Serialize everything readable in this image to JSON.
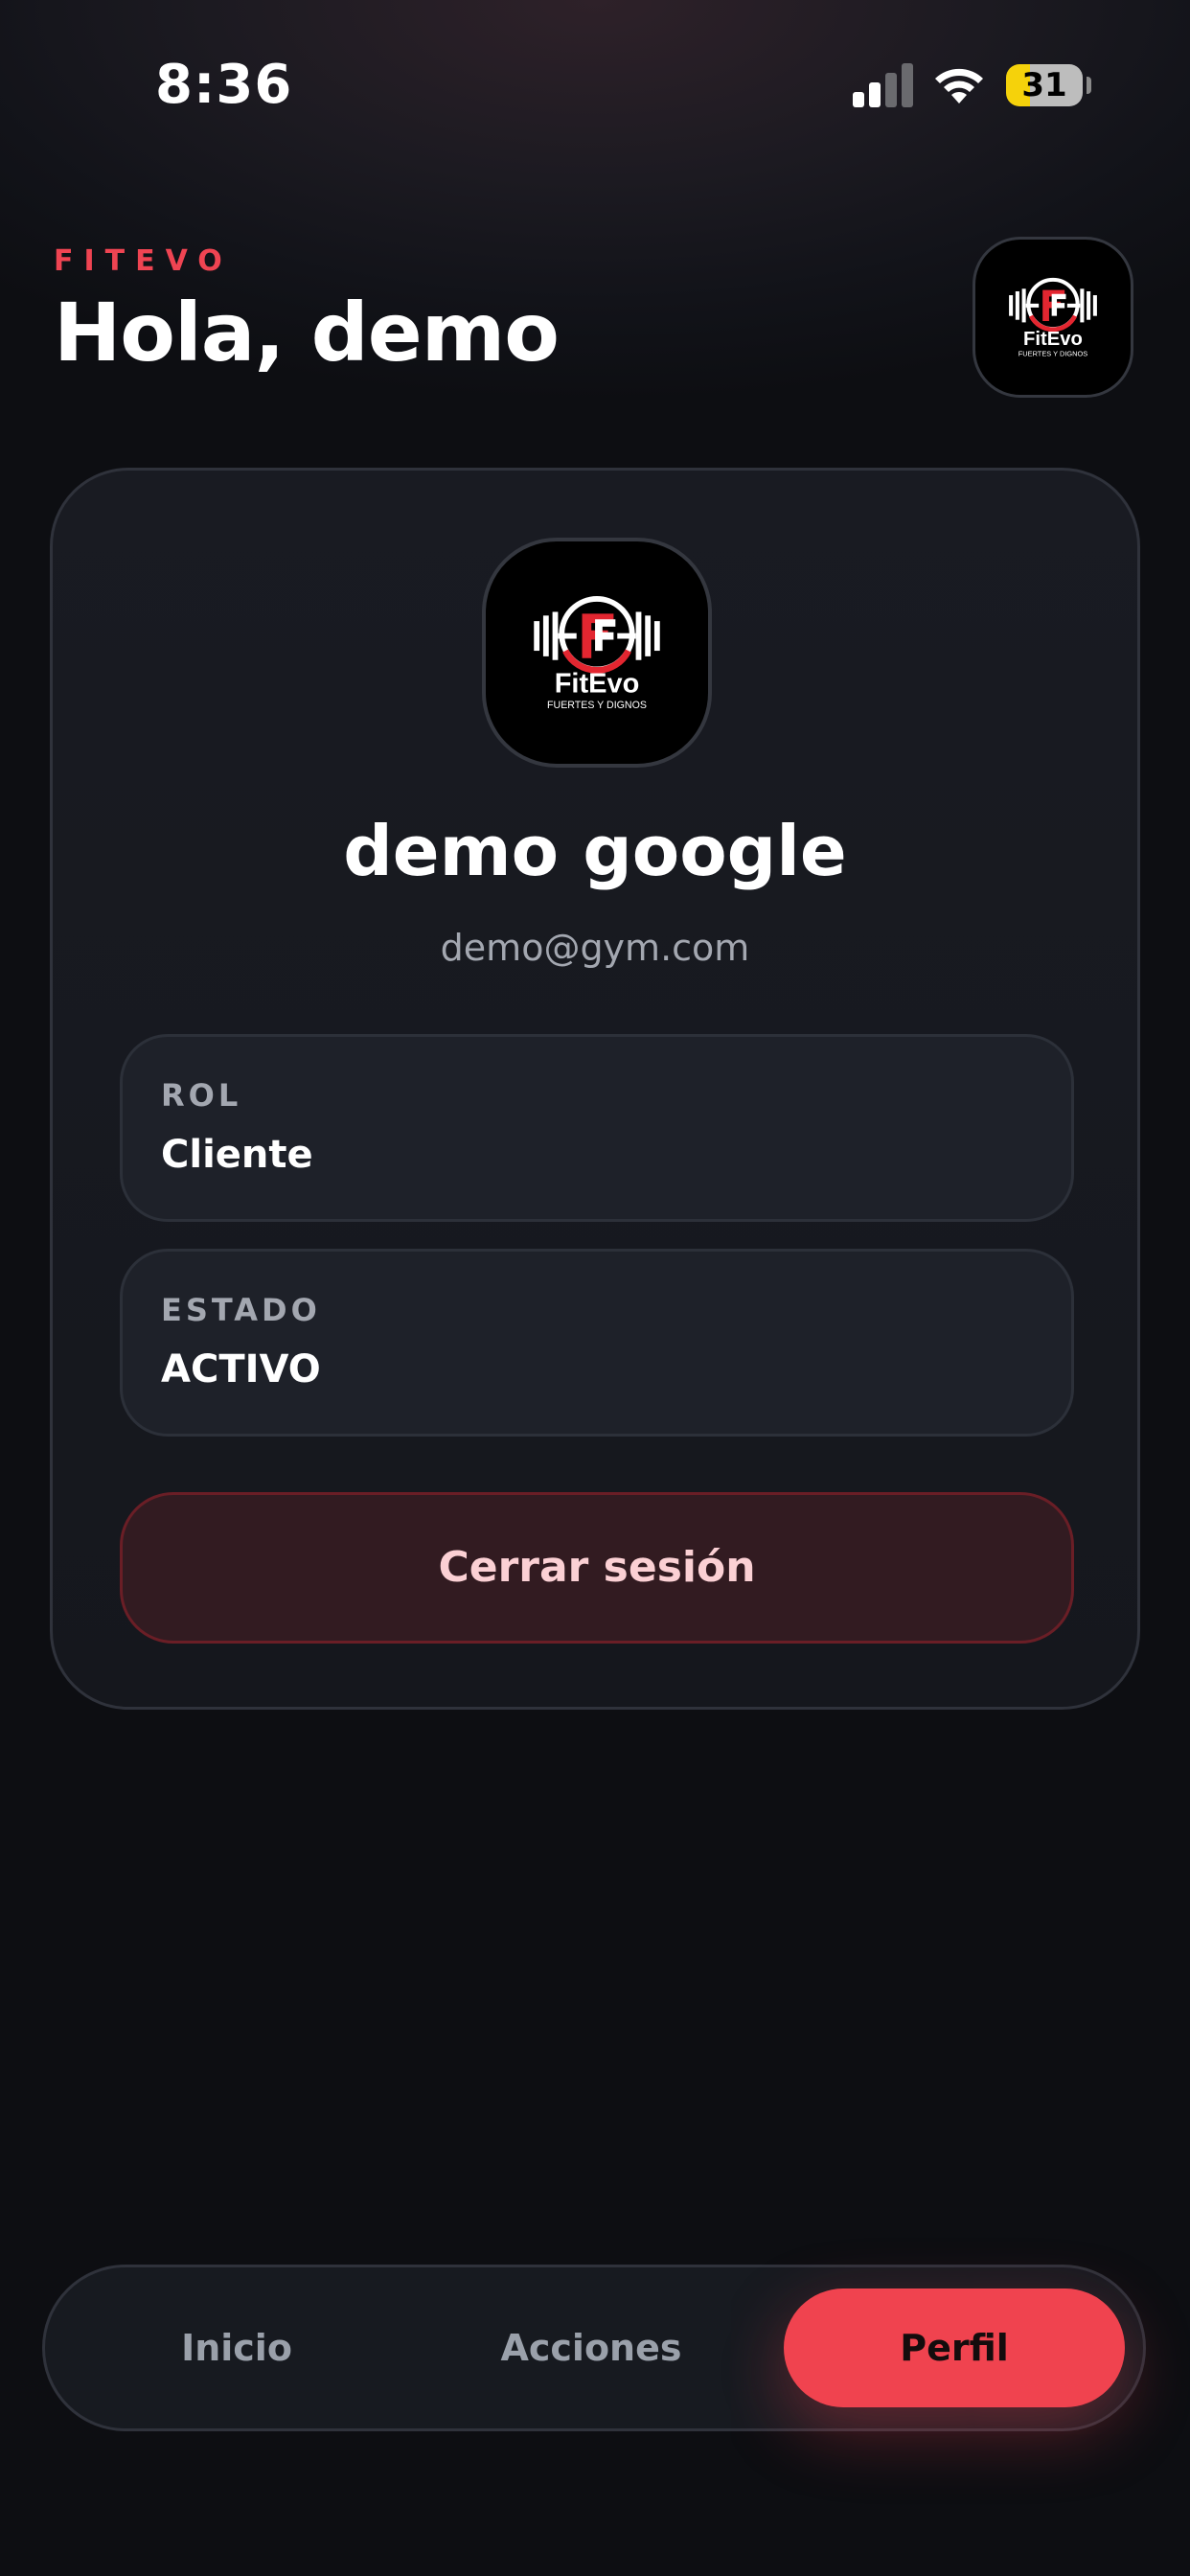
{
  "status_bar": {
    "time": "8:36",
    "battery_level": "31",
    "icons": [
      "cellular-signal-icon",
      "wifi-icon",
      "battery-icon"
    ]
  },
  "header": {
    "brand": "FITEVO",
    "greeting": "Hola, demo"
  },
  "logo": {
    "wordmark": "FitEvo",
    "tagline": "FUERTES Y DIGNOS"
  },
  "profile": {
    "name": "demo google",
    "email": "demo@gym.com",
    "fields": [
      {
        "label": "ROL",
        "value": "Cliente"
      },
      {
        "label": "ESTADO",
        "value": "ACTIVO"
      }
    ],
    "logout_label": "Cerrar sesión"
  },
  "tabs": [
    {
      "label": "Inicio",
      "active": false
    },
    {
      "label": "Acciones",
      "active": false
    },
    {
      "label": "Perfil",
      "active": true
    }
  ],
  "colors": {
    "accent": "#f0434f",
    "background": "#0e0f13",
    "card": "#171920",
    "muted_text": "#a3a7b0",
    "logout_bg": "#321b21",
    "battery": "#f5d20b"
  }
}
